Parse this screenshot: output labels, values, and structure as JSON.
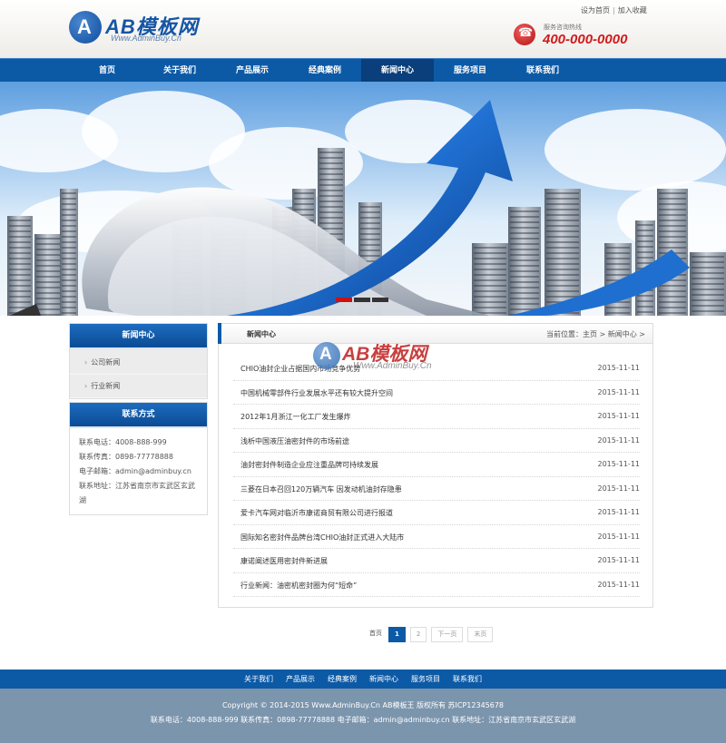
{
  "header": {
    "logo_letter": "A",
    "logo_text": "AB模板网",
    "logo_url": "Www.AdminBuy.Cn",
    "top_links": [
      "设为首页",
      "加入收藏"
    ],
    "hotline_label": "服务咨询热线",
    "hotline_number": "400-000-0000"
  },
  "nav": {
    "items": [
      "首页",
      "关于我们",
      "产品展示",
      "经典案例",
      "新闻中心",
      "服务项目",
      "联系我们"
    ],
    "active": "新闻中心"
  },
  "banner": {
    "slide_count": 3,
    "active_slide": 1
  },
  "sidebar": {
    "category_title": "新闻中心",
    "categories": [
      "公司新闻",
      "行业新闻"
    ],
    "contact_title": "联系方式",
    "contact": {
      "phone": "联系电话：4008-888-999",
      "fax": "联系传真：0898-77778888",
      "email": "电子邮箱：admin@adminbuy.cn",
      "address": "联系地址：江苏省南京市玄武区玄武湖"
    }
  },
  "main": {
    "title": "新闻中心",
    "breadcrumb": "当前位置：主页 > 新闻中心 >",
    "news": [
      {
        "title": "CHIO油封企业占据国内市场竞争优势",
        "date": "2015-11-11"
      },
      {
        "title": "中国机械零部件行业发展水平还有较大提升空间",
        "date": "2015-11-11"
      },
      {
        "title": "2012年1月浙江一化工厂发生爆炸",
        "date": "2015-11-11"
      },
      {
        "title": "浅析中国液压油密封件的市场前途",
        "date": "2015-11-11"
      },
      {
        "title": "油封密封件制造企业应注重品牌可持续发展",
        "date": "2015-11-11"
      },
      {
        "title": "三菱在日本召回120万辆汽车 因发动机油封存隐患",
        "date": "2015-11-11"
      },
      {
        "title": "爱卡汽车网对临沂市康诺商贸有限公司进行报道",
        "date": "2015-11-11"
      },
      {
        "title": "国际知名密封件品牌台湾CHIO油封正式进入大陆市",
        "date": "2015-11-11"
      },
      {
        "title": "康诺阐述医用密封件新进展",
        "date": "2015-11-11"
      },
      {
        "title": "行业新闻：油密机密封圈为何“短命”",
        "date": "2015-11-11"
      }
    ],
    "watermark": {
      "letter": "A",
      "text": "AB模板网",
      "url": "Www.AdminBuy.Cn"
    }
  },
  "pager": {
    "label": "首页",
    "pages": [
      "1",
      "2"
    ],
    "current": "1",
    "next": "下一页",
    "last": "末页"
  },
  "footer": {
    "nav": [
      "关于我们",
      "产品展示",
      "经典案例",
      "新闻中心",
      "服务项目",
      "联系我们"
    ],
    "copyright": "Copyright © 2014-2015 Www.AdminBuy.Cn AB模板王 版权所有 苏ICP12345678",
    "contact_line": "联系电话：4008-888-999 联系传真：0898-77778888 电子邮箱：admin@adminbuy.cn 联系地址：江苏省南京市玄武区玄武湖"
  },
  "colors": {
    "primary": "#0c5aa6",
    "nav_active": "#0a3f7c",
    "hotline": "#d11a1a",
    "footer_bg": "#7b95ad"
  }
}
